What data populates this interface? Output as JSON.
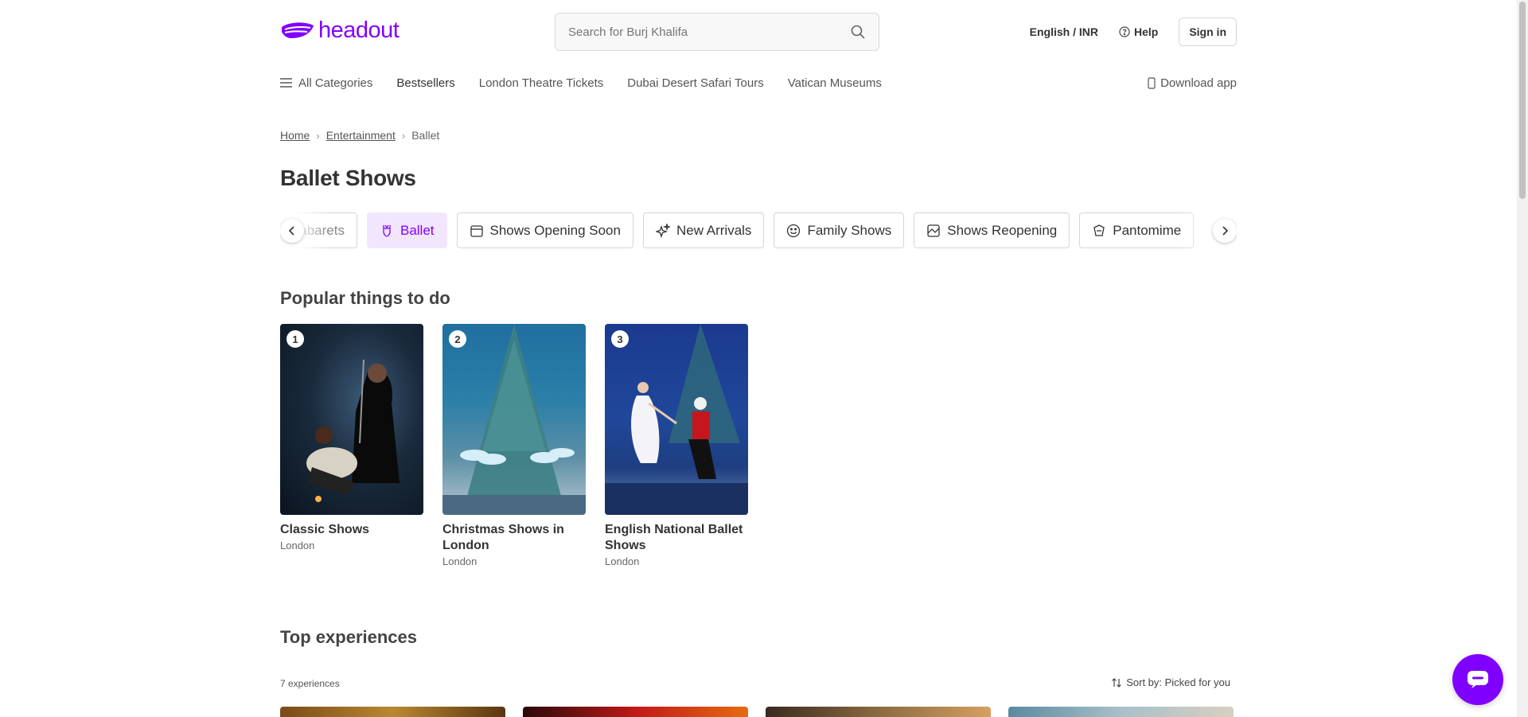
{
  "header": {
    "logo_text": "headout",
    "search_placeholder": "Search for Burj Khalifa",
    "language_currency": "English / INR",
    "help_label": "Help",
    "signin_label": "Sign in"
  },
  "nav": {
    "all_categories": "All Categories",
    "items": [
      "Bestsellers",
      "London Theatre Tickets",
      "Dubai Desert Safari Tours",
      "Vatican Museums"
    ],
    "download_app": "Download app"
  },
  "breadcrumb": {
    "home": "Home",
    "entertainment": "Entertainment",
    "current": "Ballet"
  },
  "page_title": "Ballet Shows",
  "chips": [
    {
      "label": "Cabarets",
      "icon": "cabaret-icon"
    },
    {
      "label": "Ballet",
      "icon": "ballet-icon",
      "active": true
    },
    {
      "label": "Shows Opening Soon",
      "icon": "calendar-icon"
    },
    {
      "label": "New Arrivals",
      "icon": "sparkle-icon"
    },
    {
      "label": "Family Shows",
      "icon": "smiley-icon"
    },
    {
      "label": "Shows Reopening",
      "icon": "reopening-icon"
    },
    {
      "label": "Pantomime",
      "icon": "pantomime-icon"
    }
  ],
  "popular": {
    "title": "Popular things to do",
    "cards": [
      {
        "rank": "1",
        "name": "Classic Shows",
        "city": "London"
      },
      {
        "rank": "2",
        "name": "Christmas Shows in London",
        "city": "London"
      },
      {
        "rank": "3",
        "name": "English National Ballet Shows",
        "city": "London"
      }
    ]
  },
  "top_experiences": {
    "title": "Top experiences",
    "count": "7 experiences",
    "sort_label": "Sort by: Picked for you"
  },
  "colors": {
    "brand": "#8000ff",
    "active_chip_bg": "#f2e6ff"
  }
}
